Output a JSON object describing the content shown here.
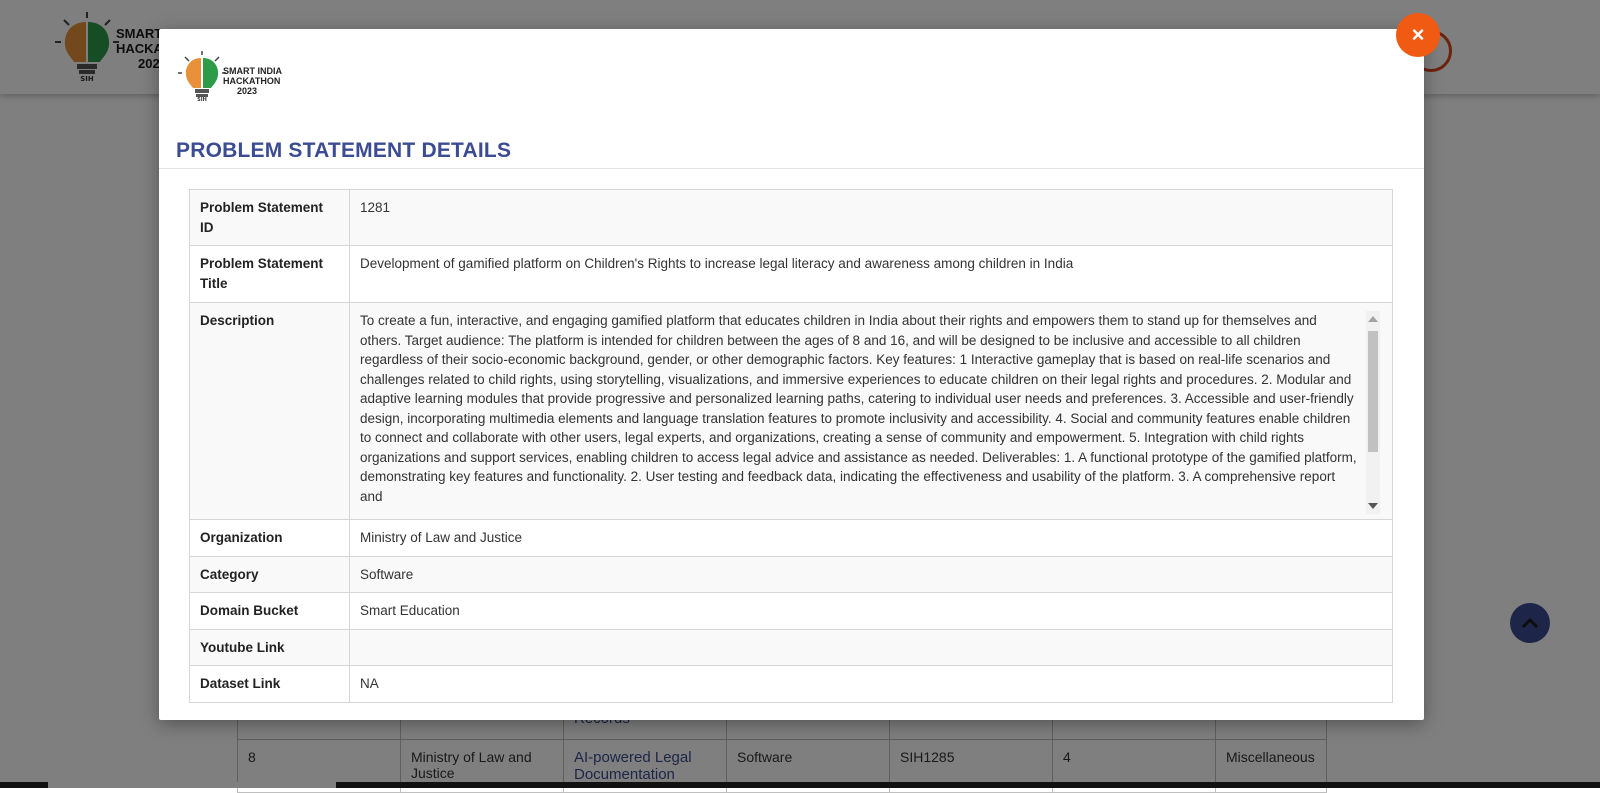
{
  "background": {
    "header_logo_text": [
      "SMART",
      "HACKA",
      "202"
    ],
    "table_rows": [
      {
        "col1": "",
        "col2": "",
        "col3": "Records",
        "col4": "",
        "col5": "",
        "col6": "",
        "col7": ""
      },
      {
        "col1": "8",
        "col2": "Ministry of Law and Justice",
        "col3": "AI-powered Legal Documentation",
        "col4": "Software",
        "col5": "SIH1285",
        "col6": "4",
        "col7": "Miscellaneous"
      }
    ]
  },
  "modal": {
    "close_label": "×",
    "logo_text": [
      "SMART INDIA",
      "HACKATHON",
      "2023"
    ],
    "title": "PROBLEM STATEMENT DETAILS",
    "rows": [
      {
        "label": "Problem Statement ID",
        "value": "1281"
      },
      {
        "label": "Problem Statement Title",
        "value": "Development of gamified platform on Children's Rights to increase legal literacy and awareness among children in India"
      },
      {
        "label": "Description",
        "value": "To create a fun, interactive, and engaging gamified platform that educates children in India about their rights and empowers them to stand up for themselves and others. Target audience: The platform is intended for children between the ages of 8 and 16, and will be designed to be inclusive and accessible to all children regardless of their socio-economic background, gender, or other demographic factors. Key features: 1 Interactive gameplay that is based on real-life scenarios and challenges related to child rights, using storytelling, visualizations, and immersive experiences to educate children on their legal rights and procedures. 2. Modular and adaptive learning modules that provide progressive and personalized learning paths, catering to individual user needs and preferences. 3. Accessible and user-friendly design, incorporating multimedia elements and language translation features to promote inclusivity and accessibility. 4. Social and community features enable children to connect and collaborate with other users, legal experts, and organizations, creating a sense of community and empowerment. 5. Integration with child rights organizations and support services, enabling children to access legal advice and assistance as needed. Deliverables: 1. A functional prototype of the gamified platform, demonstrating key features and functionality. 2. User testing and feedback data, indicating the effectiveness and usability of the platform. 3. A comprehensive report and"
      },
      {
        "label": "Organization",
        "value": "Ministry of Law and Justice"
      },
      {
        "label": "Category",
        "value": "Software"
      },
      {
        "label": "Domain Bucket",
        "value": "Smart Education"
      },
      {
        "label": "Youtube Link",
        "value": ""
      },
      {
        "label": "Dataset Link",
        "value": "NA"
      }
    ]
  },
  "icons": {
    "close": "close-icon",
    "scroll_top": "chevron-up-icon"
  },
  "colors": {
    "accent": "#3b4c92",
    "close": "#f15a12"
  }
}
